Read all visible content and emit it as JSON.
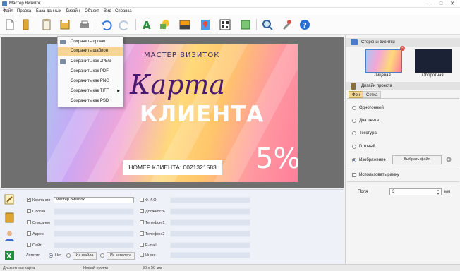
{
  "window": {
    "title": "Мастер Визиток",
    "controls": [
      "—",
      "□",
      "✕"
    ]
  },
  "menubar": [
    "Файл",
    "Правка",
    "База данных",
    "Дизайн",
    "Объект",
    "Вид",
    "Справка"
  ],
  "toolbar_icons": [
    "new-file-icon",
    "open-icon",
    "templates-icon",
    "save-icon",
    "print-icon",
    "undo-icon",
    "redo-icon",
    "text-icon",
    "shapes-icon",
    "image-icon",
    "map-icon",
    "qr-code-icon",
    "crop-icon",
    "zoom-icon",
    "tools-icon",
    "help-icon"
  ],
  "dropdown": {
    "items": [
      {
        "label": "Сохранить проект",
        "highlight": false,
        "submenu": false
      },
      {
        "label": "Сохранить шаблон",
        "highlight": true,
        "submenu": false
      },
      {
        "label": "Сохранить как JPEG",
        "highlight": false,
        "submenu": false
      },
      {
        "label": "Сохранить как PDF",
        "highlight": false,
        "submenu": false
      },
      {
        "label": "Сохранить как PNG",
        "highlight": false,
        "submenu": false
      },
      {
        "label": "Сохранить как TIFF",
        "highlight": false,
        "submenu": true
      },
      {
        "label": "Сохранить как PSD",
        "highlight": false,
        "submenu": false
      }
    ],
    "submenu_arrow": "▶"
  },
  "card": {
    "brand": "МАСТЕР ВИЗИТОК",
    "line1": "Карта",
    "line2": "КЛИЕНТА",
    "discount": "5%",
    "client_number": "НОМЕР КЛИЕНТА: 0021321583"
  },
  "right_panel": {
    "sides_title": "Стороны визитки",
    "front_label": "Лицевая",
    "back_label": "Оборотная",
    "design_title": "Дизайн проекта",
    "tabs": [
      "Фон",
      "Сетка"
    ],
    "bg_options": [
      {
        "label": "Однотонный",
        "selected": false
      },
      {
        "label": "Два цвета",
        "selected": false
      },
      {
        "label": "Текстура",
        "selected": false
      },
      {
        "label": "Готовый",
        "selected": false
      },
      {
        "label": "Изображение",
        "selected": true
      }
    ],
    "choose_file_button": "Выбрать файл",
    "use_frame_label": "Использовать рамку",
    "use_frame_checked": false,
    "margins_label": "Поля",
    "margins_value": "3",
    "margins_unit": "мм"
  },
  "bottom_form": {
    "left_fields": [
      {
        "label": "Компания",
        "value": "Мастер Визиток",
        "checked": true
      },
      {
        "label": "Слоган",
        "value": "",
        "checked": false
      },
      {
        "label": "Описание",
        "value": "",
        "checked": false
      },
      {
        "label": "Адрес",
        "value": "",
        "checked": false
      },
      {
        "label": "Сайт",
        "value": "",
        "checked": false
      }
    ],
    "right_fields": [
      {
        "label": "Ф.И.О.",
        "value": "",
        "checked": false
      },
      {
        "label": "Должность",
        "value": "",
        "checked": false
      },
      {
        "label": "Телефон 1",
        "value": "",
        "checked": false
      },
      {
        "label": "Телефон 2",
        "value": "",
        "checked": false
      },
      {
        "label": "E-mail",
        "value": "",
        "checked": false
      },
      {
        "label": "Инфо",
        "value": "",
        "checked": false
      }
    ],
    "logo_label": "Логотип",
    "logo_options": [
      {
        "label": "Нет",
        "selected": true
      },
      {
        "label": "Из файла",
        "selected": false
      },
      {
        "label": "Из каталога",
        "selected": false
      }
    ]
  },
  "statusbar": {
    "type": "Дисконтная карта",
    "project": "Новый проект",
    "size": "90 x 50 мм"
  },
  "colors": {
    "highlight": "#f6d595",
    "panel_title": "#e2e2e2",
    "card_text_dark": "#4a1b6d"
  }
}
